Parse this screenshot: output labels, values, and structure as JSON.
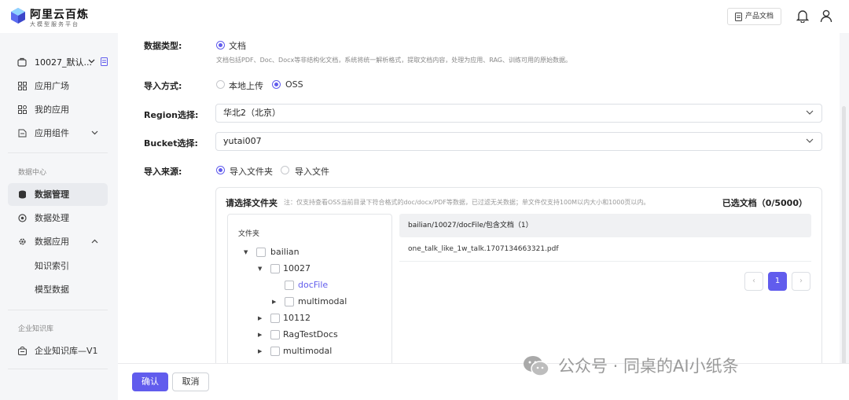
{
  "header": {
    "brand": "阿里云百炼",
    "brand_sub": "大模型服务平台",
    "doc_button": "产品文档"
  },
  "sidebar": {
    "workspace": "10027_默认...",
    "items_top": [
      {
        "label": "应用广场"
      },
      {
        "label": "我的应用"
      },
      {
        "label": "应用组件"
      }
    ],
    "section_data": "数据中心",
    "items_data": [
      {
        "label": "数据管理"
      },
      {
        "label": "数据处理"
      },
      {
        "label": "数据应用"
      },
      {
        "label": "知识索引"
      },
      {
        "label": "模型数据"
      }
    ],
    "section_kb": "企业知识库",
    "kb_item": "企业知识库—V1"
  },
  "form": {
    "data_type_label": "数据类型:",
    "data_type_value": "文档",
    "data_type_hint": "文档包括PDF、Doc、Docx等非结构化文档，系统将统一解析格式，提取文档内容，处理为应用、RAG、训练可用的原始数据。",
    "import_method_label": "导入方式:",
    "import_local": "本地上传",
    "import_oss": "OSS",
    "region_label": "Region选择:",
    "region_value": "华北2（北京）",
    "bucket_label": "Bucket选择:",
    "bucket_value": "yutai007",
    "source_label": "导入来源:",
    "source_folder": "导入文件夹",
    "source_file": "导入文件"
  },
  "panel": {
    "title": "请选择文件夹",
    "note": "注：仅支持查看OSS当前目录下符合格式的doc/docx/PDF等数据，已过滤无关数据；单文件仅支持100M以内大小和1000页以内。",
    "count": "已选文档（0/5000）",
    "tree_header": "文件夹",
    "tree": [
      {
        "label": "bailian"
      },
      {
        "label": "10027"
      },
      {
        "label": "docFile"
      },
      {
        "label": "multimodal"
      },
      {
        "label": "10112"
      },
      {
        "label": "RagTestDocs"
      },
      {
        "label": "multimodal"
      }
    ],
    "list_header": "bailian/10027/docFile/包含文档（1）",
    "files": [
      "one_talk_like_1w_talk.1707134663321.pdf"
    ],
    "page": "1"
  },
  "footer": {
    "confirm": "确认",
    "cancel": "取消"
  },
  "watermark": "公众号 · 同桌的AI小纸条",
  "colors": {
    "accent": "#615ced"
  }
}
